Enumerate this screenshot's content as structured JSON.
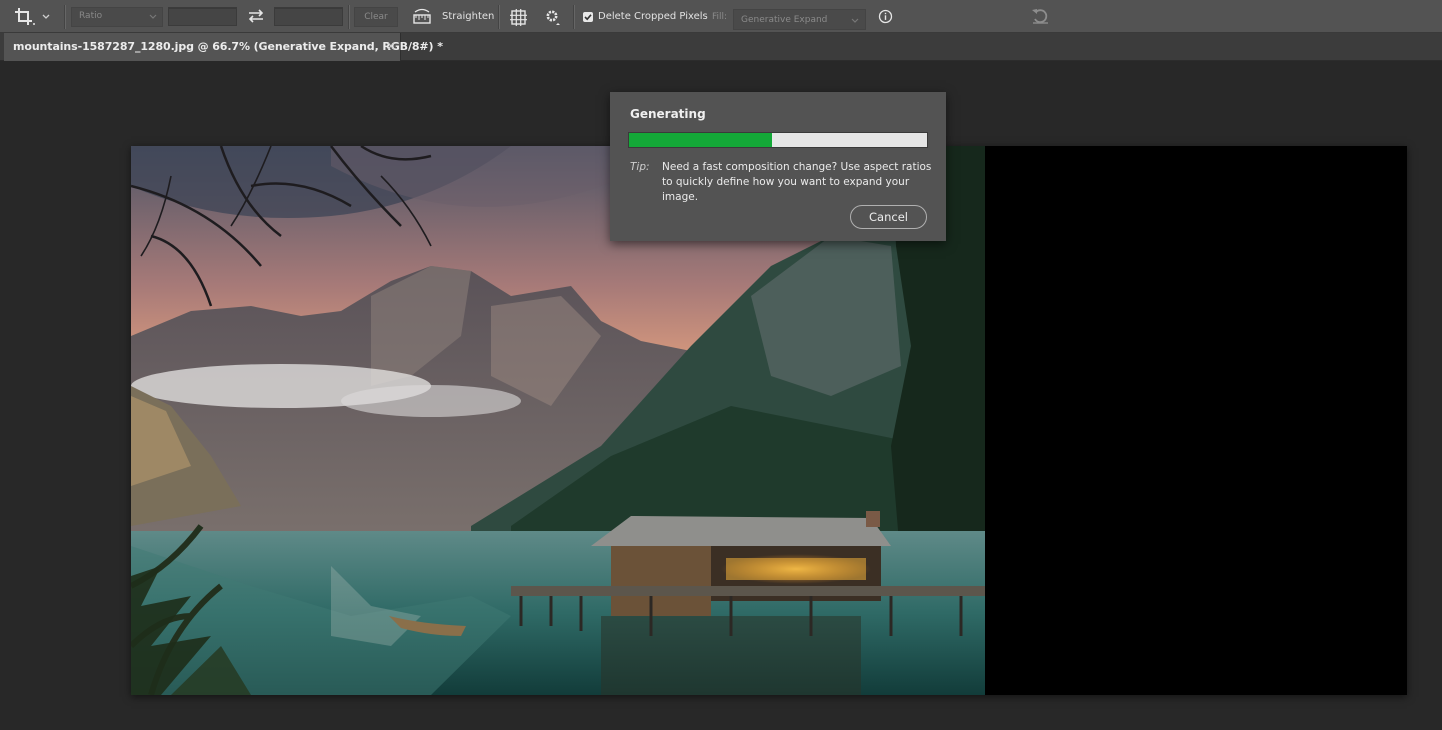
{
  "options_bar": {
    "ratio_label": "Ratio",
    "width_value": "",
    "height_value": "",
    "clear_label": "Clear",
    "straighten_label": "Straighten",
    "delete_cropped_label": "Delete Cropped Pixels",
    "delete_cropped_checked": true,
    "fill_label": "Fill:",
    "fill_value": "Generative Expand"
  },
  "document": {
    "tab_title": "mountains-1587287_1280.jpg @ 66.7% (Generative Expand, RGB/8#) *"
  },
  "dialog": {
    "title": "Generating",
    "progress": 0.48,
    "tip_label": "Tip:",
    "tip_text": "Need a fast composition change? Use aspect ratios to quickly define how you want to expand your image.",
    "cancel_label": "Cancel"
  },
  "colors": {
    "progress_fill": "#14a838",
    "ui_panel": "#535353",
    "workspace": "#282828"
  }
}
